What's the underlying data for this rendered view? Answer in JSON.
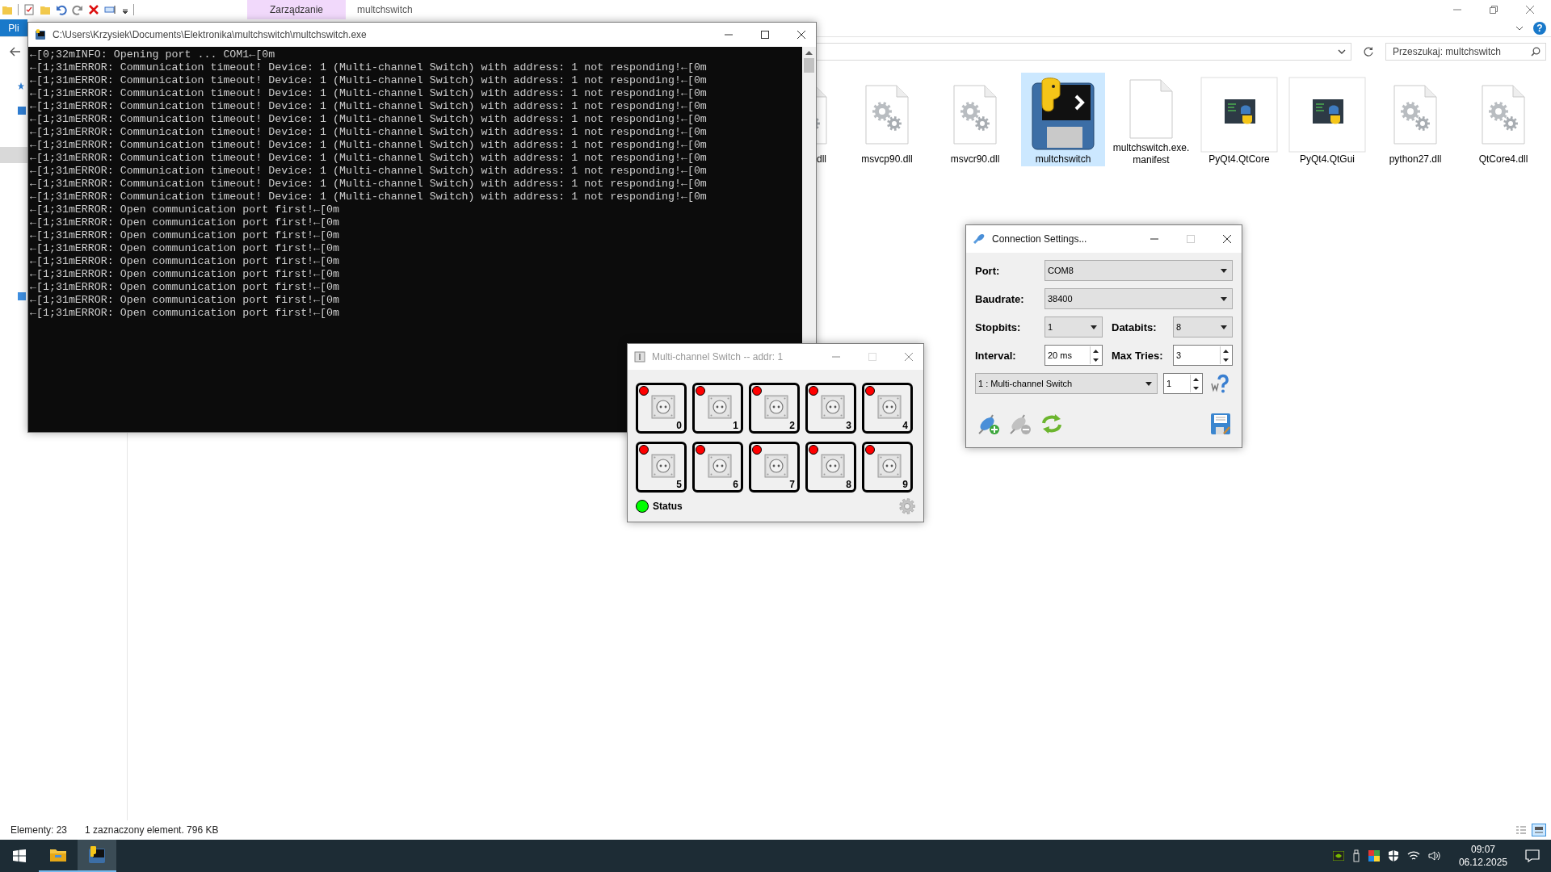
{
  "explorer": {
    "title": "multchswitch",
    "context_tab": "Zarządzanie",
    "file_tab": "Pli",
    "help": "?",
    "search": {
      "placeholder": "Przeszukaj: multchswitch"
    },
    "files": [
      {
        "name": "dll",
        "kind": "gears",
        "cut": true,
        "selected": false
      },
      {
        "name": "msvcp90.dll",
        "kind": "gears",
        "cut": false,
        "selected": false
      },
      {
        "name": "msvcr90.dll",
        "kind": "gears",
        "cut": false,
        "selected": false
      },
      {
        "name": "multchswitch",
        "kind": "app",
        "cut": false,
        "selected": true
      },
      {
        "name": "multchswitch.exe.manifest",
        "kind": "blank",
        "cut": false,
        "selected": false
      },
      {
        "name": "PyQt4.QtCore",
        "kind": "python",
        "cut": false,
        "selected": false
      },
      {
        "name": "PyQt4.QtGui",
        "kind": "python",
        "cut": false,
        "selected": false
      },
      {
        "name": "python27.dll",
        "kind": "gears",
        "cut": false,
        "selected": false
      },
      {
        "name": "QtCore4.dll",
        "kind": "gears",
        "cut": false,
        "selected": false
      }
    ],
    "status_bar": {
      "count": "Elementy: 23",
      "selection": "1 zaznaczony element. 796 KB"
    }
  },
  "console": {
    "title": "C:\\Users\\Krzysiek\\Documents\\Elektronika\\multchswitch\\multchswitch.exe",
    "lines": [
      "←[0;32mINFO: Opening port ... COM1←[0m",
      "←[1;31mERROR: Communication timeout! Device: 1 (Multi-channel Switch) with address: 1 not responding!←[0m",
      "←[1;31mERROR: Communication timeout! Device: 1 (Multi-channel Switch) with address: 1 not responding!←[0m",
      "←[1;31mERROR: Communication timeout! Device: 1 (Multi-channel Switch) with address: 1 not responding!←[0m",
      "←[1;31mERROR: Communication timeout! Device: 1 (Multi-channel Switch) with address: 1 not responding!←[0m",
      "←[1;31mERROR: Communication timeout! Device: 1 (Multi-channel Switch) with address: 1 not responding!←[0m",
      "←[1;31mERROR: Communication timeout! Device: 1 (Multi-channel Switch) with address: 1 not responding!←[0m",
      "←[1;31mERROR: Communication timeout! Device: 1 (Multi-channel Switch) with address: 1 not responding!←[0m",
      "←[1;31mERROR: Communication timeout! Device: 1 (Multi-channel Switch) with address: 1 not responding!←[0m",
      "←[1;31mERROR: Communication timeout! Device: 1 (Multi-channel Switch) with address: 1 not responding!←[0m",
      "←[1;31mERROR: Communication timeout! Device: 1 (Multi-channel Switch) with address: 1 not responding!←[0m",
      "←[1;31mERROR: Communication timeout! Device: 1 (Multi-channel Switch) with address: 1 not responding!←[0m",
      "←[1;31mERROR: Open communication port first!←[0m",
      "←[1;31mERROR: Open communication port first!←[0m",
      "←[1;31mERROR: Open communication port first!←[0m",
      "←[1;31mERROR: Open communication port first!←[0m",
      "←[1;31mERROR: Open communication port first!←[0m",
      "←[1;31mERROR: Open communication port first!←[0m",
      "←[1;31mERROR: Open communication port first!←[0m",
      "←[1;31mERROR: Open communication port first!←[0m",
      "←[1;31mERROR: Open communication port first!←[0m"
    ]
  },
  "switch_window": {
    "title": "Multi-channel Switch -- addr: 1",
    "channels": [
      {
        "label": "0",
        "on": false
      },
      {
        "label": "1",
        "on": false
      },
      {
        "label": "2",
        "on": false
      },
      {
        "label": "3",
        "on": false
      },
      {
        "label": "4",
        "on": false
      },
      {
        "label": "5",
        "on": false
      },
      {
        "label": "6",
        "on": false
      },
      {
        "label": "7",
        "on": false
      },
      {
        "label": "8",
        "on": false
      },
      {
        "label": "9",
        "on": false
      }
    ],
    "status": {
      "label": "Status",
      "on": true
    }
  },
  "connection_settings": {
    "title": "Connection Settings...",
    "port": {
      "label": "Port:",
      "value": "COM8"
    },
    "baudrate": {
      "label": "Baudrate:",
      "value": "38400"
    },
    "stopbits": {
      "label": "Stopbits:",
      "value": "1"
    },
    "databits": {
      "label": "Databits:",
      "value": "8"
    },
    "interval": {
      "label": "Interval:",
      "value": "20 ms"
    },
    "max_tries": {
      "label": "Max Tries:",
      "value": "3"
    },
    "device": {
      "value": "1 : Multi-channel Switch"
    },
    "address": {
      "value": "1"
    },
    "buttons": [
      {
        "kind": "connect",
        "disabled": false
      },
      {
        "kind": "disconnect",
        "disabled": true
      },
      {
        "kind": "refresh",
        "disabled": false
      }
    ]
  },
  "taskbar": {
    "apps": [
      {
        "kind": "explorer",
        "selected": false
      },
      {
        "kind": "python",
        "selected": true
      }
    ],
    "time": "09:07",
    "date": "06.12.2025"
  }
}
